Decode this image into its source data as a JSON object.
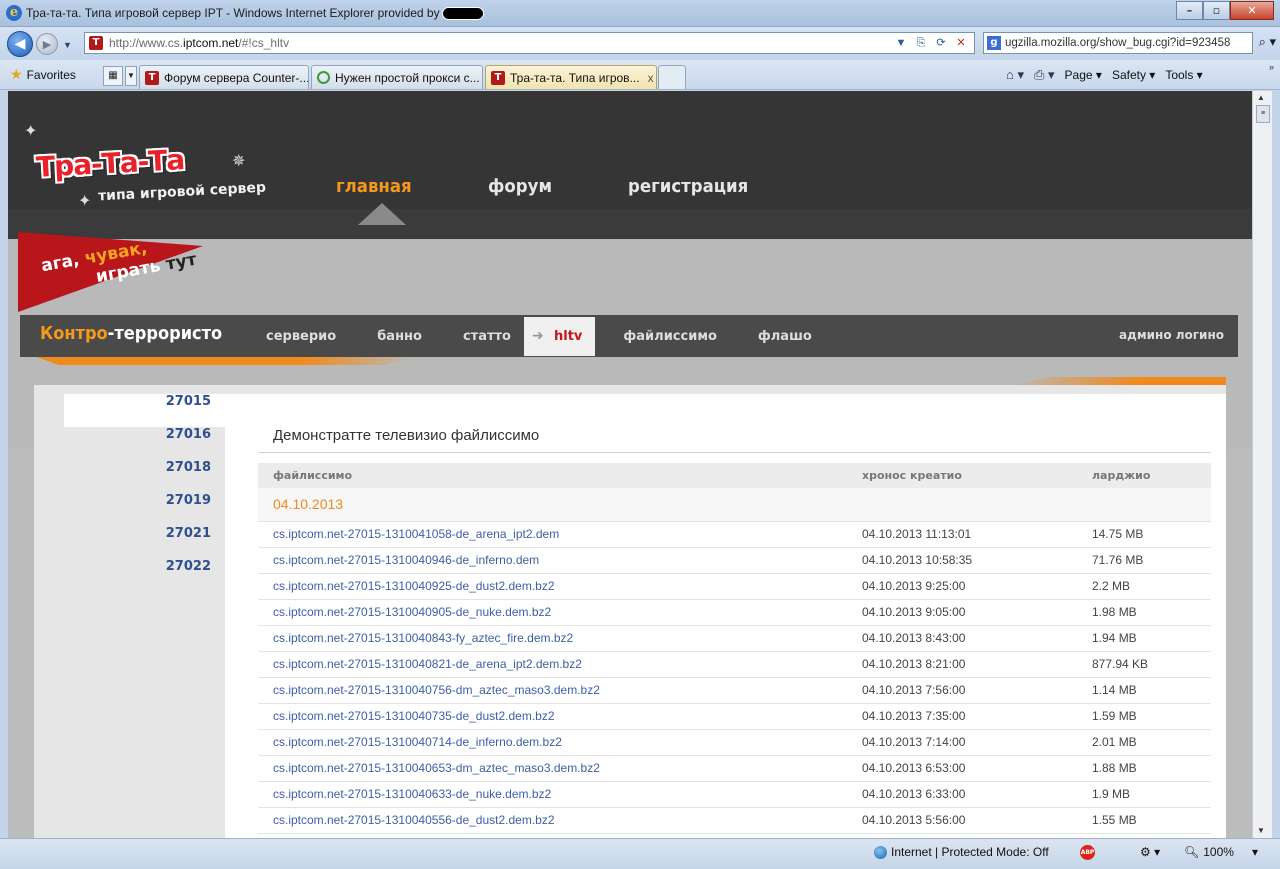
{
  "window": {
    "title": "Тра-та-та. Типа игровой сервер IPT - Windows Internet Explorer provided by",
    "minimize": "–",
    "maximize": "▫",
    "close": "✕"
  },
  "address_bar": {
    "url_prefix": "http://www.cs.",
    "url_domain": "iptcom.net",
    "url_suffix": "/#!cs_hltv",
    "search_text": "ugzilla.mozilla.org/show_bug.cgi?id=923458"
  },
  "favorites_bar": {
    "favorites_label": "Favorites",
    "tabs": [
      {
        "label": "Форум сервера Counter-...",
        "active": false
      },
      {
        "label": "Нужен простой прокси с...",
        "active": false
      },
      {
        "label": "Тра-та-та. Типа игров...",
        "active": true
      }
    ],
    "tab_close": "x",
    "commands": {
      "page": "Page",
      "safety": "Safety",
      "tools": "Tools"
    }
  },
  "site": {
    "logo": "Тра-Та-Та",
    "logo_sub": "типа игровой сервер",
    "slogan": {
      "part1": "ага, ",
      "part2": "чувак,",
      "part3": "играть ",
      "part4": "тут"
    },
    "top_nav": [
      {
        "label": "главная",
        "active": true
      },
      {
        "label": "форум",
        "active": false
      },
      {
        "label": "регистрация",
        "active": false
      }
    ],
    "section_title": {
      "part1": "Контро",
      "part2": "-террористо"
    },
    "sub_nav": [
      {
        "label": "серверио",
        "active": false
      },
      {
        "label": "банно",
        "active": false
      },
      {
        "label": "статто",
        "active": false
      },
      {
        "label": "hltv",
        "active": true
      },
      {
        "label": "файлиссимо",
        "active": false
      },
      {
        "label": "флашо",
        "active": false
      }
    ],
    "admin_login": "админо логино"
  },
  "sidebar": {
    "ports": [
      {
        "label": "27015",
        "active": true
      },
      {
        "label": "27016",
        "active": false
      },
      {
        "label": "27018",
        "active": false
      },
      {
        "label": "27019",
        "active": false
      },
      {
        "label": "27021",
        "active": false
      },
      {
        "label": "27022",
        "active": false
      }
    ]
  },
  "main": {
    "title": "Демонстратте телевизио файлиссимо",
    "columns": {
      "name": "файлиссимо",
      "created": "хронос креатио",
      "size": "ларджио"
    },
    "date_group": "04.10.2013",
    "files": [
      {
        "name": "cs.iptcom.net-27015-1310041058-de_arena_ipt2.dem",
        "created": "04.10.2013 11:13:01",
        "size": "14.75 MB"
      },
      {
        "name": "cs.iptcom.net-27015-1310040946-de_inferno.dem",
        "created": "04.10.2013 10:58:35",
        "size": "71.76 MB"
      },
      {
        "name": "cs.iptcom.net-27015-1310040925-de_dust2.dem.bz2",
        "created": "04.10.2013 9:25:00",
        "size": "2.2 MB"
      },
      {
        "name": "cs.iptcom.net-27015-1310040905-de_nuke.dem.bz2",
        "created": "04.10.2013 9:05:00",
        "size": "1.98 MB"
      },
      {
        "name": "cs.iptcom.net-27015-1310040843-fy_aztec_fire.dem.bz2",
        "created": "04.10.2013 8:43:00",
        "size": "1.94 MB"
      },
      {
        "name": "cs.iptcom.net-27015-1310040821-de_arena_ipt2.dem.bz2",
        "created": "04.10.2013 8:21:00",
        "size": "877.94 KB"
      },
      {
        "name": "cs.iptcom.net-27015-1310040756-dm_aztec_maso3.dem.bz2",
        "created": "04.10.2013 7:56:00",
        "size": "1.14 MB"
      },
      {
        "name": "cs.iptcom.net-27015-1310040735-de_dust2.dem.bz2",
        "created": "04.10.2013 7:35:00",
        "size": "1.59 MB"
      },
      {
        "name": "cs.iptcom.net-27015-1310040714-de_inferno.dem.bz2",
        "created": "04.10.2013 7:14:00",
        "size": "2.01 MB"
      },
      {
        "name": "cs.iptcom.net-27015-1310040653-dm_aztec_maso3.dem.bz2",
        "created": "04.10.2013 6:53:00",
        "size": "1.88 MB"
      },
      {
        "name": "cs.iptcom.net-27015-1310040633-de_nuke.dem.bz2",
        "created": "04.10.2013 6:33:00",
        "size": "1.9 MB"
      },
      {
        "name": "cs.iptcom.net-27015-1310040556-de_dust2.dem.bz2",
        "created": "04.10.2013 5:56:00",
        "size": "1.55 MB"
      }
    ]
  },
  "status_bar": {
    "zone": "Internet | Protected Mode: Off",
    "abp": "ABP",
    "zoom": "100%"
  }
}
